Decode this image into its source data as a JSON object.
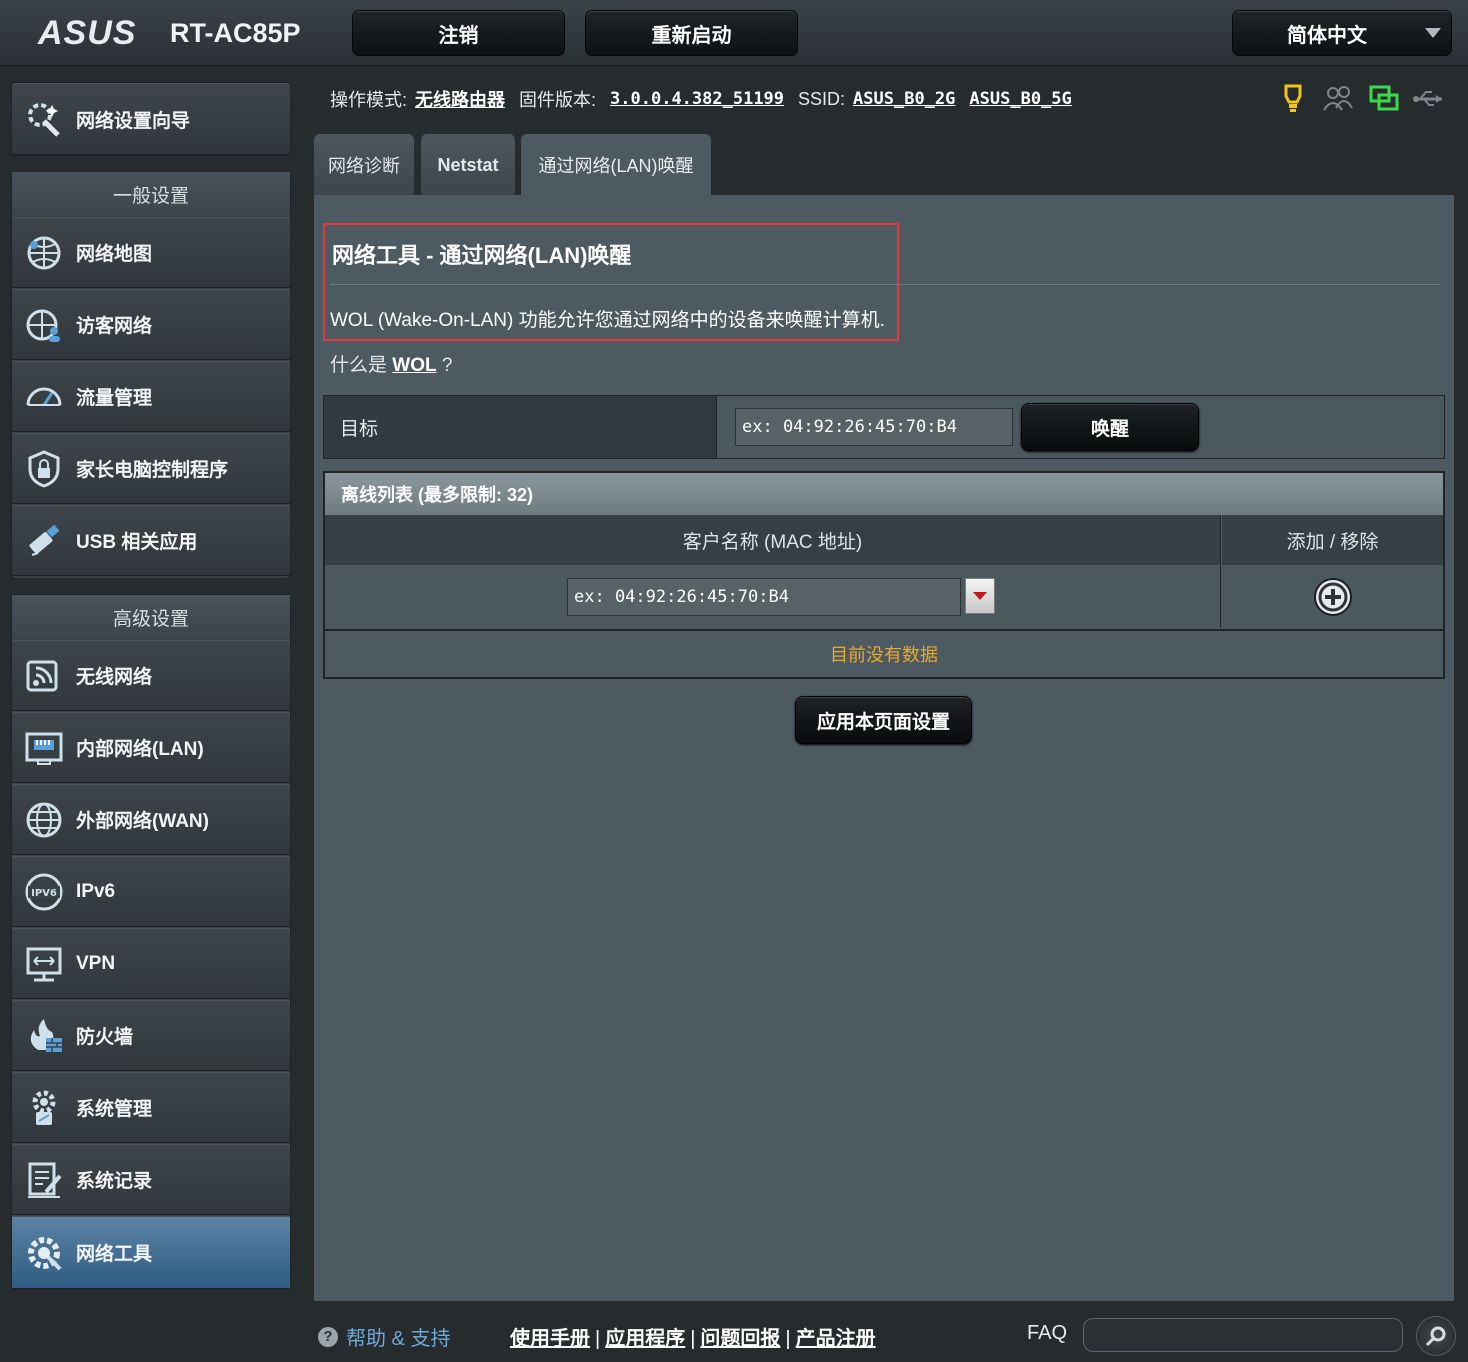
{
  "brand": {
    "logo": "ASUS",
    "model": "RT-AC85P"
  },
  "topbar": {
    "logout_label": "注销",
    "reboot_label": "重新启动",
    "language_label": "简体中文"
  },
  "sidebar": {
    "wizard_label": "网络设置向导",
    "general_header": "一般设置",
    "general_items": [
      {
        "label": "网络地图",
        "icon": "network-map-icon"
      },
      {
        "label": "访客网络",
        "icon": "guest-network-icon"
      },
      {
        "label": "流量管理",
        "icon": "traffic-manager-icon"
      },
      {
        "label": "家长电脑控制程序",
        "icon": "parental-control-icon"
      },
      {
        "label": "USB 相关应用",
        "icon": "usb-application-icon"
      }
    ],
    "advanced_header": "高级设置",
    "advanced_items": [
      {
        "label": "无线网络",
        "icon": "wireless-icon"
      },
      {
        "label": "内部网络(LAN)",
        "icon": "lan-icon"
      },
      {
        "label": "外部网络(WAN)",
        "icon": "wan-icon"
      },
      {
        "label": "IPv6",
        "icon": "ipv6-icon"
      },
      {
        "label": "VPN",
        "icon": "vpn-icon"
      },
      {
        "label": "防火墙",
        "icon": "firewall-icon"
      },
      {
        "label": "系统管理",
        "icon": "administration-icon"
      },
      {
        "label": "系统记录",
        "icon": "system-log-icon"
      },
      {
        "label": "网络工具",
        "icon": "network-tools-icon"
      }
    ]
  },
  "status": {
    "mode_label": "操作模式:",
    "mode_value": "无线路由器",
    "firmware_label": "固件版本:",
    "firmware_value": "3.0.0.4.382_51199",
    "ssid_label": "SSID:",
    "ssid_2g": "ASUS_B0_2G",
    "ssid_5g": "ASUS_B0_5G"
  },
  "tabs": [
    {
      "label": "网络诊断"
    },
    {
      "label": "Netstat"
    },
    {
      "label": "通过网络(LAN)唤醒"
    }
  ],
  "main": {
    "title": "网络工具 - 通过网络(LAN)唤醒",
    "description": "WOL (Wake-On-LAN) 功能允许您通过网络中的设备来唤醒计算机.",
    "whatis_prefix": "什么是",
    "whatis_link": "WOL",
    "whatis_suffix": "?",
    "target_label": "目标",
    "target_placeholder": "ex: 04:92:26:45:70:B4",
    "wake_button": "唤醒",
    "offline_list_title": "离线列表 (最多限制: 32)",
    "col_client": "客户名称 (MAC 地址)",
    "col_add_remove": "添加 / 移除",
    "client_placeholder": "ex: 04:92:26:45:70:B4",
    "no_data": "目前没有数据",
    "apply_button": "应用本页面设置"
  },
  "footer": {
    "help_label": "帮助 & 支持",
    "links": [
      "使用手册",
      "应用程序",
      "问题回报",
      "产品注册"
    ],
    "faq_label": "FAQ"
  }
}
